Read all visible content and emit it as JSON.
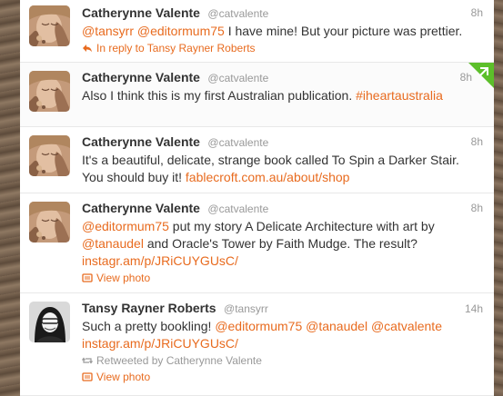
{
  "colors": {
    "link": "#e86b1f",
    "muted": "#999999",
    "name": "#333333",
    "fold": "#5cbf2a"
  },
  "tweets": [
    {
      "name": "Catherynne Valente",
      "handle": "@catvalente",
      "time": "8h",
      "parts": [
        {
          "t": "@tansyrr",
          "link": true
        },
        {
          "t": " ",
          "link": false
        },
        {
          "t": "@editormum75",
          "link": true
        },
        {
          "t": " I have mine! But your picture was prettier.",
          "link": false
        }
      ],
      "meta": {
        "icon": "reply-arrow-icon",
        "label": "In reply to Tansy Rayner Roberts"
      }
    },
    {
      "name": "Catherynne Valente",
      "handle": "@catvalente",
      "time": "8h",
      "parts": [
        {
          "t": "Also I think this is my first Australian publication. ",
          "link": false
        },
        {
          "t": "#iheartaustralia",
          "link": true
        }
      ]
    },
    {
      "name": "Catherynne Valente",
      "handle": "@catvalente",
      "time": "8h",
      "parts": [
        {
          "t": "It's a beautiful, delicate, strange book called To Spin a Darker Stair. You should buy it! ",
          "link": false
        },
        {
          "t": "fablecroft.com.au/about/shop",
          "link": true
        }
      ]
    },
    {
      "name": "Catherynne Valente",
      "handle": "@catvalente",
      "time": "8h",
      "parts": [
        {
          "t": "@editormum75",
          "link": true
        },
        {
          "t": " put my story A Delicate Architecture with art by ",
          "link": false
        },
        {
          "t": "@tanaudel",
          "link": true
        },
        {
          "t": " and Oracle's Tower by Faith Mudge. The result? ",
          "link": false
        },
        {
          "t": "instagr.am/p/JRiCUYGUsC/",
          "link": true
        }
      ],
      "meta": {
        "icon": "photo-icon",
        "label": "View photo"
      }
    },
    {
      "name": "Tansy Rayner Roberts",
      "handle": "@tansyrr",
      "time": "14h",
      "parts": [
        {
          "t": "Such a pretty bookling! ",
          "link": false
        },
        {
          "t": "@editormum75",
          "link": true
        },
        {
          "t": " ",
          "link": false
        },
        {
          "t": "@tanaudel",
          "link": true
        },
        {
          "t": " ",
          "link": false
        },
        {
          "t": "@catvalente",
          "link": true
        },
        {
          "t": " ",
          "link": false
        },
        {
          "t": "instagr.am/p/JRiCUYGUsC/",
          "link": true
        }
      ],
      "retweet": {
        "icon": "retweet-icon",
        "label": "Retweeted by Catherynne Valente"
      },
      "meta": {
        "icon": "photo-icon",
        "label": "View photo"
      }
    }
  ]
}
